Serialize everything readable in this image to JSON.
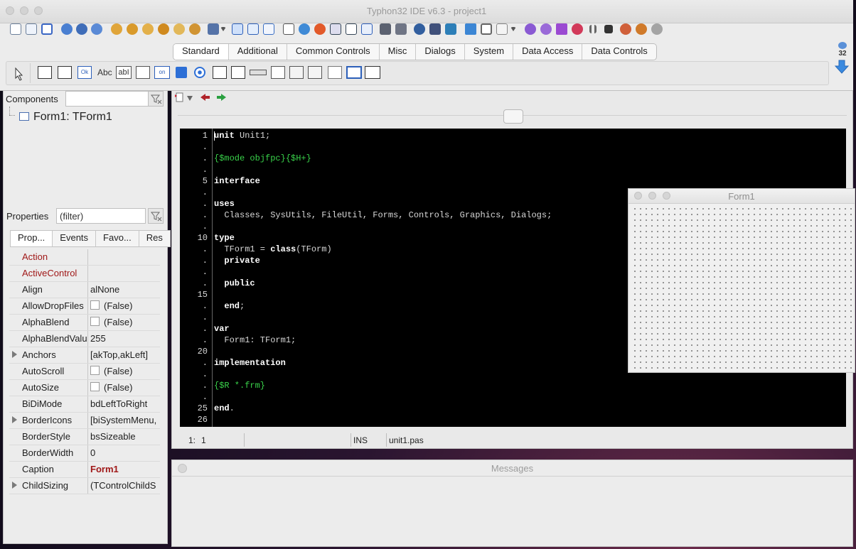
{
  "app": {
    "title": "Typhon32 IDE v6.3 - project1"
  },
  "palette": {
    "tabs": [
      "Standard",
      "Additional",
      "Common Controls",
      "Misc",
      "Dialogs",
      "System",
      "Data Access",
      "Data Controls"
    ],
    "active_tab": "Standard",
    "bitness_label": "32",
    "button_labels": {
      "ok": "Ok",
      "abc": "Abc",
      "abl": "abI",
      "on": "on"
    }
  },
  "components": {
    "label": "Components",
    "tree": [
      {
        "label": "Form1: TForm1"
      }
    ]
  },
  "properties": {
    "label": "Properties",
    "filter_placeholder": "(filter)",
    "tabs": [
      "Prop...",
      "Events",
      "Favo...",
      "Res"
    ],
    "rows": [
      {
        "name": "Action",
        "value": "",
        "highlight": true
      },
      {
        "name": "ActiveControl",
        "value": "",
        "highlight": true
      },
      {
        "name": "Align",
        "value": "alNone"
      },
      {
        "name": "AllowDropFiles",
        "value": "(False)",
        "checkbox": true
      },
      {
        "name": "AlphaBlend",
        "value": "(False)",
        "checkbox": true
      },
      {
        "name": "AlphaBlendValue",
        "value": "255"
      },
      {
        "name": "Anchors",
        "value": "[akTop,akLeft]",
        "expandable": true
      },
      {
        "name": "AutoScroll",
        "value": "(False)",
        "checkbox": true
      },
      {
        "name": "AutoSize",
        "value": "(False)",
        "checkbox": true
      },
      {
        "name": "BiDiMode",
        "value": "bdLeftToRight"
      },
      {
        "name": "BorderIcons",
        "value": "[biSystemMenu,",
        "expandable": true
      },
      {
        "name": "BorderStyle",
        "value": "bsSizeable"
      },
      {
        "name": "BorderWidth",
        "value": "0"
      },
      {
        "name": "Caption",
        "value": "Form1",
        "value_bold": true
      },
      {
        "name": "ChildSizing",
        "value": "(TControlChildS",
        "expandable": true
      }
    ]
  },
  "editor": {
    "gutter": [
      "1",
      ".",
      ".",
      ".",
      "5",
      ".",
      ".",
      ".",
      ".",
      "10",
      ".",
      ".",
      ".",
      ".",
      "15",
      ".",
      ".",
      ".",
      ".",
      "20",
      ".",
      ".",
      ".",
      ".",
      "25",
      "26"
    ],
    "lines": [
      [
        {
          "t": "unit ",
          "c": "kw"
        },
        {
          "t": "Unit1;",
          "c": ""
        }
      ],
      [],
      [
        {
          "t": "{$mode objfpc}{$H+}",
          "c": "dir"
        }
      ],
      [],
      [
        {
          "t": "interface",
          "c": "kw"
        }
      ],
      [],
      [
        {
          "t": "uses",
          "c": "kw"
        }
      ],
      [
        {
          "t": "  Classes, SysUtils, FileUtil, Forms, Controls, Graphics, Dialogs;",
          "c": ""
        }
      ],
      [],
      [
        {
          "t": "type",
          "c": "kw"
        }
      ],
      [
        {
          "t": "  TForm1 = ",
          "c": ""
        },
        {
          "t": "class",
          "c": "kw"
        },
        {
          "t": "(TForm)",
          "c": ""
        }
      ],
      [
        {
          "t": "  private",
          "c": "kw"
        }
      ],
      [],
      [
        {
          "t": "  public",
          "c": "kw"
        }
      ],
      [],
      [
        {
          "t": "  end",
          "c": "kw"
        },
        {
          "t": ";",
          "c": ""
        }
      ],
      [],
      [
        {
          "t": "var",
          "c": "kw"
        }
      ],
      [
        {
          "t": "  Form1: TForm1;",
          "c": ""
        }
      ],
      [],
      [
        {
          "t": "implementation",
          "c": "kw"
        }
      ],
      [],
      [
        {
          "t": "{$R *.frm}",
          "c": "dir"
        }
      ],
      [],
      [
        {
          "t": "end",
          "c": "kw"
        },
        {
          "t": ".",
          "c": ""
        }
      ],
      []
    ],
    "status": {
      "line": "1:",
      "col": "1",
      "mode": "INS",
      "file": "unit1.pas"
    }
  },
  "messages": {
    "title": "Messages"
  },
  "designer": {
    "title": "Form1"
  },
  "colors": {
    "editor_bg": "#000000",
    "keyword": "#ffffff",
    "directive": "#39d24a",
    "property_highlight": "#a01818"
  }
}
